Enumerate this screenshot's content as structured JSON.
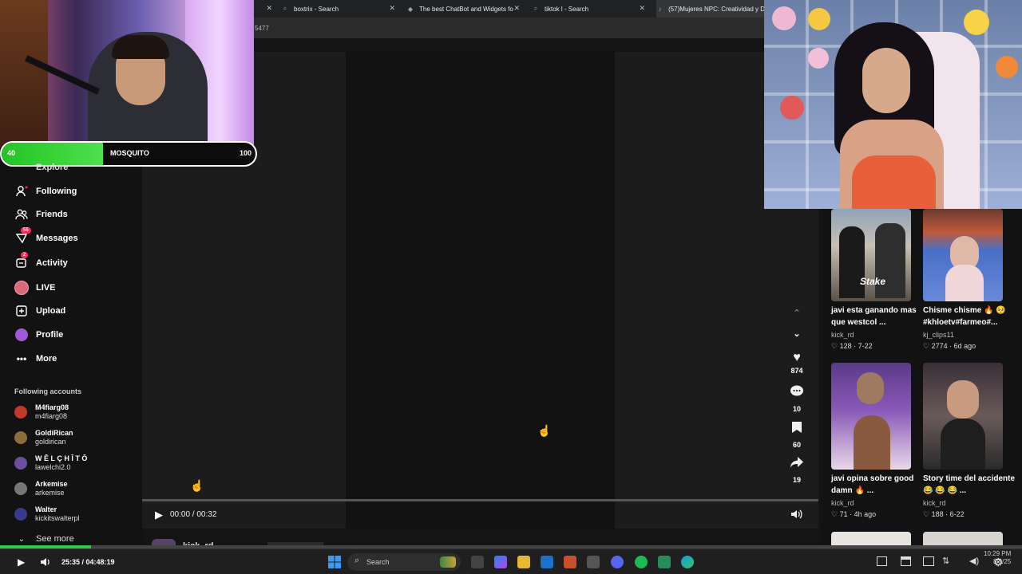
{
  "browser": {
    "tabs": [
      {
        "label": "boxtrix - Search",
        "icon": "search-icon"
      },
      {
        "label": "The best ChatBot and Widgets fo",
        "icon": "diamond-icon"
      },
      {
        "label": "tiktok l - Search",
        "icon": "search-icon"
      },
      {
        "label": "(57)Mujeres NPC: Creatividad y D",
        "icon": "tiktok-icon"
      }
    ],
    "address_fragment": "5477"
  },
  "overlay": {
    "hp_left": "40",
    "hp_label": "MOSQUITO",
    "hp_right": "100",
    "hp_fill_percent": 40
  },
  "sidebar": {
    "partial_item": "Explore",
    "items": [
      {
        "label": "Following",
        "icon": "following-icon"
      },
      {
        "label": "Friends",
        "icon": "friends-icon"
      },
      {
        "label": "Messages",
        "icon": "messages-icon",
        "badge": "55"
      },
      {
        "label": "Activity",
        "icon": "activity-icon",
        "badge": "2"
      },
      {
        "label": "LIVE",
        "icon": "live-icon"
      },
      {
        "label": "Upload",
        "icon": "upload-icon"
      },
      {
        "label": "Profile",
        "icon": "profile-icon"
      },
      {
        "label": "More",
        "icon": "more-icon"
      }
    ],
    "following_title": "Following accounts",
    "accounts": [
      {
        "name": "M4fiarg08",
        "handle": "m4fiarg08"
      },
      {
        "name": "GoldiRican",
        "handle": "goldirican"
      },
      {
        "name": "W Ē L Ç H Ī T Ō",
        "handle": "lawelchi2.0"
      },
      {
        "name": "Arkemise",
        "handle": "arkemise"
      },
      {
        "name": "Walter",
        "handle": "kickitswalterpl"
      }
    ],
    "see_more": "See more"
  },
  "player": {
    "time": "00:00 / 00:32",
    "author_partial": "kick_rd",
    "likes": "874",
    "comments": "10",
    "saves": "60",
    "shares": "19"
  },
  "related": [
    {
      "title": "javi esta ganando mas que westcol ...",
      "user": "kick_rd",
      "stats": "128 · 7-22"
    },
    {
      "title": "Chisme chisme 🔥 🥺 #khloetv#farmeo#...",
      "user": "kj_clips11",
      "stats": "2774 · 6d ago"
    },
    {
      "title": "javi opina sobre good damn 🔥 ...",
      "user": "kick_rd",
      "stats": "71 · 4h ago"
    },
    {
      "title": "Story time del accidente 😂 😂 😂 ...",
      "user": "kick_rd",
      "stats": "188 · 6-22"
    }
  ],
  "thumb_text": "Stake",
  "stream": {
    "time": "25:35 / 04:48:19",
    "progress_fraction": 0.089
  },
  "taskbar": {
    "search": "Search",
    "clock_time": "10:29 PM",
    "clock_date": "8/5/25"
  }
}
